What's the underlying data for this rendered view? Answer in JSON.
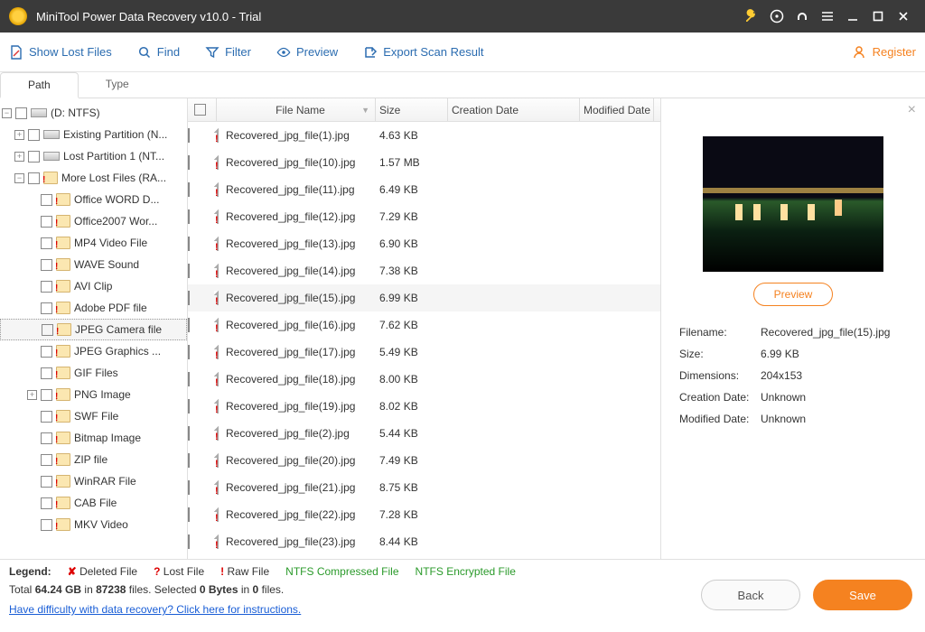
{
  "title": "MiniTool Power Data Recovery v10.0 - Trial",
  "toolbar": {
    "show_lost": "Show Lost Files",
    "find": "Find",
    "filter": "Filter",
    "preview": "Preview",
    "export": "Export Scan Result"
  },
  "register": "Register",
  "tabs": {
    "path": "Path",
    "type": "Type"
  },
  "tree": {
    "root": "(D: NTFS)",
    "items": [
      "Existing Partition (N...",
      "Lost Partition 1 (NT...",
      "More Lost Files (RA...",
      "Office WORD D...",
      "Office2007 Wor...",
      "MP4 Video File",
      "WAVE Sound",
      "AVI Clip",
      "Adobe PDF file",
      "JPEG Camera file",
      "JPEG Graphics ...",
      "GIF Files",
      "PNG Image",
      "SWF File",
      "Bitmap Image",
      "ZIP file",
      "WinRAR File",
      "CAB File",
      "MKV Video"
    ]
  },
  "columns": {
    "name": "File Name",
    "size": "Size",
    "cdate": "Creation Date",
    "mdate": "Modified Date"
  },
  "rows": [
    {
      "name": "Recovered_jpg_file(1).jpg",
      "size": "4.63 KB"
    },
    {
      "name": "Recovered_jpg_file(10).jpg",
      "size": "1.57 MB"
    },
    {
      "name": "Recovered_jpg_file(11).jpg",
      "size": "6.49 KB"
    },
    {
      "name": "Recovered_jpg_file(12).jpg",
      "size": "7.29 KB"
    },
    {
      "name": "Recovered_jpg_file(13).jpg",
      "size": "6.90 KB"
    },
    {
      "name": "Recovered_jpg_file(14).jpg",
      "size": "7.38 KB"
    },
    {
      "name": "Recovered_jpg_file(15).jpg",
      "size": "6.99 KB"
    },
    {
      "name": "Recovered_jpg_file(16).jpg",
      "size": "7.62 KB"
    },
    {
      "name": "Recovered_jpg_file(17).jpg",
      "size": "5.49 KB"
    },
    {
      "name": "Recovered_jpg_file(18).jpg",
      "size": "8.00 KB"
    },
    {
      "name": "Recovered_jpg_file(19).jpg",
      "size": "8.02 KB"
    },
    {
      "name": "Recovered_jpg_file(2).jpg",
      "size": "5.44 KB"
    },
    {
      "name": "Recovered_jpg_file(20).jpg",
      "size": "7.49 KB"
    },
    {
      "name": "Recovered_jpg_file(21).jpg",
      "size": "8.75 KB"
    },
    {
      "name": "Recovered_jpg_file(22).jpg",
      "size": "7.28 KB"
    },
    {
      "name": "Recovered_jpg_file(23).jpg",
      "size": "8.44 KB"
    }
  ],
  "selected_index": 6,
  "preview_btn": "Preview",
  "meta": {
    "label_filename": "Filename:",
    "filename": "Recovered_jpg_file(15).jpg",
    "label_size": "Size:",
    "size": "6.99 KB",
    "label_dim": "Dimensions:",
    "dim": "204x153",
    "label_cdate": "Creation Date:",
    "cdate": "Unknown",
    "label_mdate": "Modified Date:",
    "mdate": "Unknown"
  },
  "legend": {
    "title": "Legend:",
    "deleted": "Deleted File",
    "lost": "Lost File",
    "raw": "Raw File",
    "ntfs_comp": "NTFS Compressed File",
    "ntfs_enc": "NTFS Encrypted File"
  },
  "summary": {
    "p1": "Total ",
    "total": "64.24 GB",
    "p2": " in ",
    "files": "87238",
    "p3": " files.   Selected ",
    "sel_bytes": "0 Bytes",
    "p4": " in ",
    "sel_files": "0",
    "p5": " files."
  },
  "help": "Have difficulty with data recovery? Click here for instructions.",
  "buttons": {
    "back": "Back",
    "save": "Save"
  }
}
